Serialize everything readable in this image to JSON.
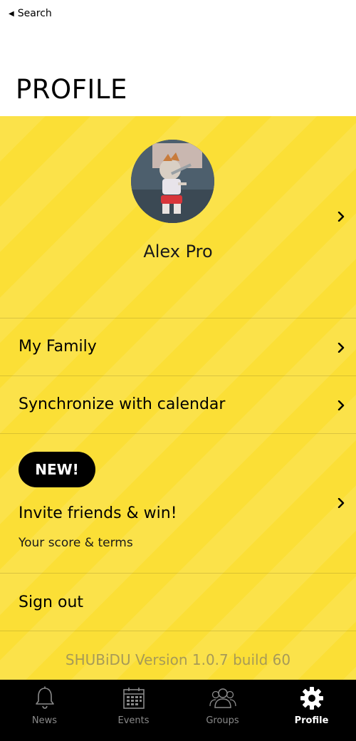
{
  "status_bar": {
    "back_label": "Search"
  },
  "header": {
    "title": "PROFILE"
  },
  "profile": {
    "name": "Alex Pro"
  },
  "menu": {
    "family_label": "My Family",
    "calendar_label": "Synchronize with calendar",
    "new_badge": "NEW!",
    "invite_label": "Invite friends & win!",
    "invite_sub": "Your score & terms",
    "signout_label": "Sign out"
  },
  "footer": {
    "version": "SHUBiDU Version 1.0.7 build 60"
  },
  "tabs": [
    {
      "label": "News",
      "icon": "bell-icon",
      "active": false
    },
    {
      "label": "Events",
      "icon": "calendar-icon",
      "active": false
    },
    {
      "label": "Groups",
      "icon": "people-icon",
      "active": false
    },
    {
      "label": "Profile",
      "icon": "gear-icon",
      "active": true
    }
  ],
  "colors": {
    "accent_yellow": "#fbdf36",
    "tab_bar": "#000000",
    "tab_inactive": "#8a8a8a",
    "tab_active": "#ffffff",
    "version_text": "#a69a57"
  }
}
